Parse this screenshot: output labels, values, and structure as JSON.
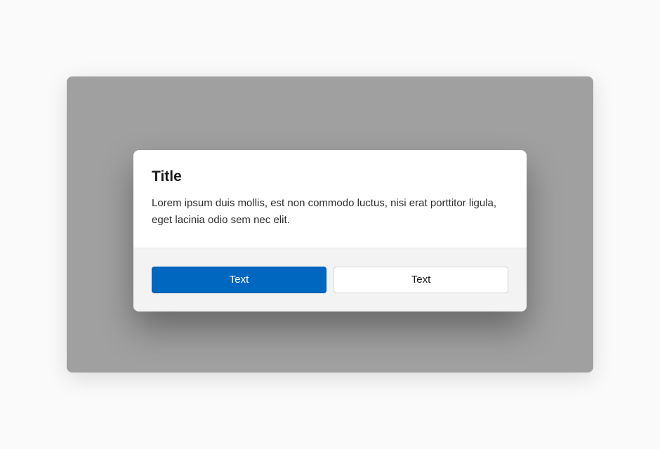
{
  "dialog": {
    "title": "Title",
    "body": "Lorem ipsum duis mollis, est non commodo luctus, nisi erat porttitor ligula, eget lacinia odio sem nec elit.",
    "primary_button_label": "Text",
    "secondary_button_label": "Text"
  }
}
